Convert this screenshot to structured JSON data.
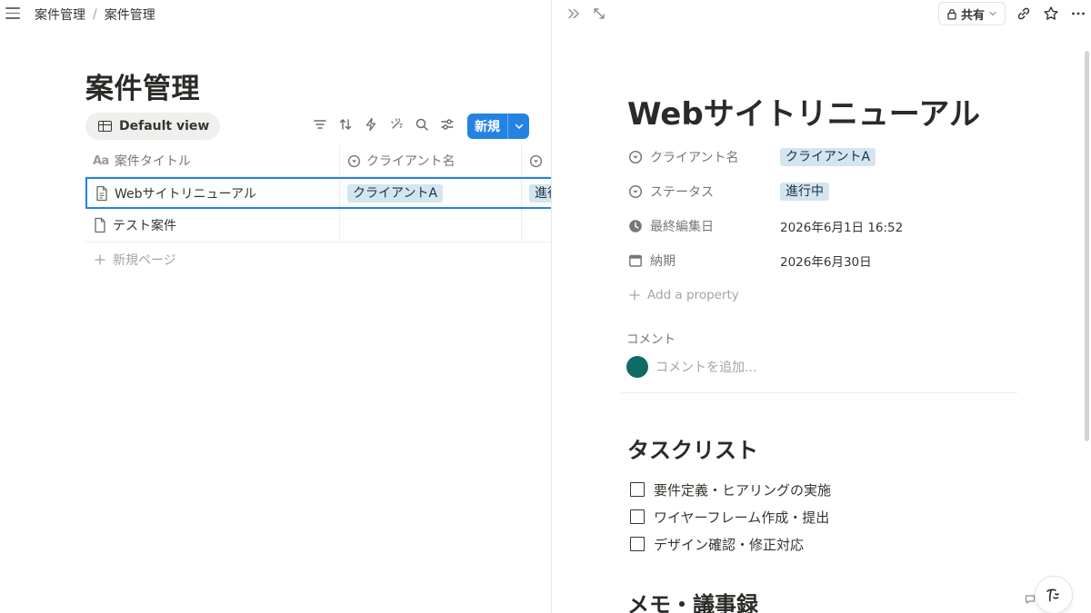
{
  "breadcrumb": {
    "items": [
      "案件管理",
      "案件管理"
    ],
    "separator": "/"
  },
  "database": {
    "title": "案件管理",
    "view_name": "Default view",
    "new_button": "新規",
    "columns": [
      {
        "name": "案件タイトル",
        "icon": "Aa"
      },
      {
        "name": "クライアント名",
        "icon": "select-icon"
      },
      {
        "name": "",
        "icon": "select-icon"
      }
    ],
    "rows": [
      {
        "title": "Webサイトリニューアル",
        "client": "クライアントA",
        "status": "進行中"
      },
      {
        "title": "テスト案件",
        "client": "",
        "status": ""
      }
    ],
    "new_page": "新規ページ"
  },
  "topbar_right": {
    "share_label": "共有"
  },
  "page": {
    "title": "Webサイトリニューアル",
    "properties": [
      {
        "key": "クライアント名",
        "value": "クライアントA",
        "kind": "tag",
        "icon": "select-icon"
      },
      {
        "key": "ステータス",
        "value": "進行中",
        "kind": "tag",
        "icon": "select-icon"
      },
      {
        "key": "最終編集日",
        "value": "2026年6月1日 16:52",
        "kind": "text",
        "icon": "clock-icon"
      },
      {
        "key": "納期",
        "value": "2026年6月30日",
        "kind": "text",
        "icon": "calendar-icon"
      }
    ],
    "add_property": "Add a property",
    "comments_label": "コメント",
    "comment_placeholder": "コメントを追加...",
    "task_heading": "タスクリスト",
    "tasks": [
      "要件定義・ヒアリングの実施",
      "ワイヤーフレーム作成・提出",
      "デザイン確認・修正対応"
    ],
    "memo_heading": "メモ・議事録"
  },
  "colors": {
    "accent": "#2383e2",
    "tag_blue": "#d3e5ef",
    "avatar": "#0f6b65"
  }
}
